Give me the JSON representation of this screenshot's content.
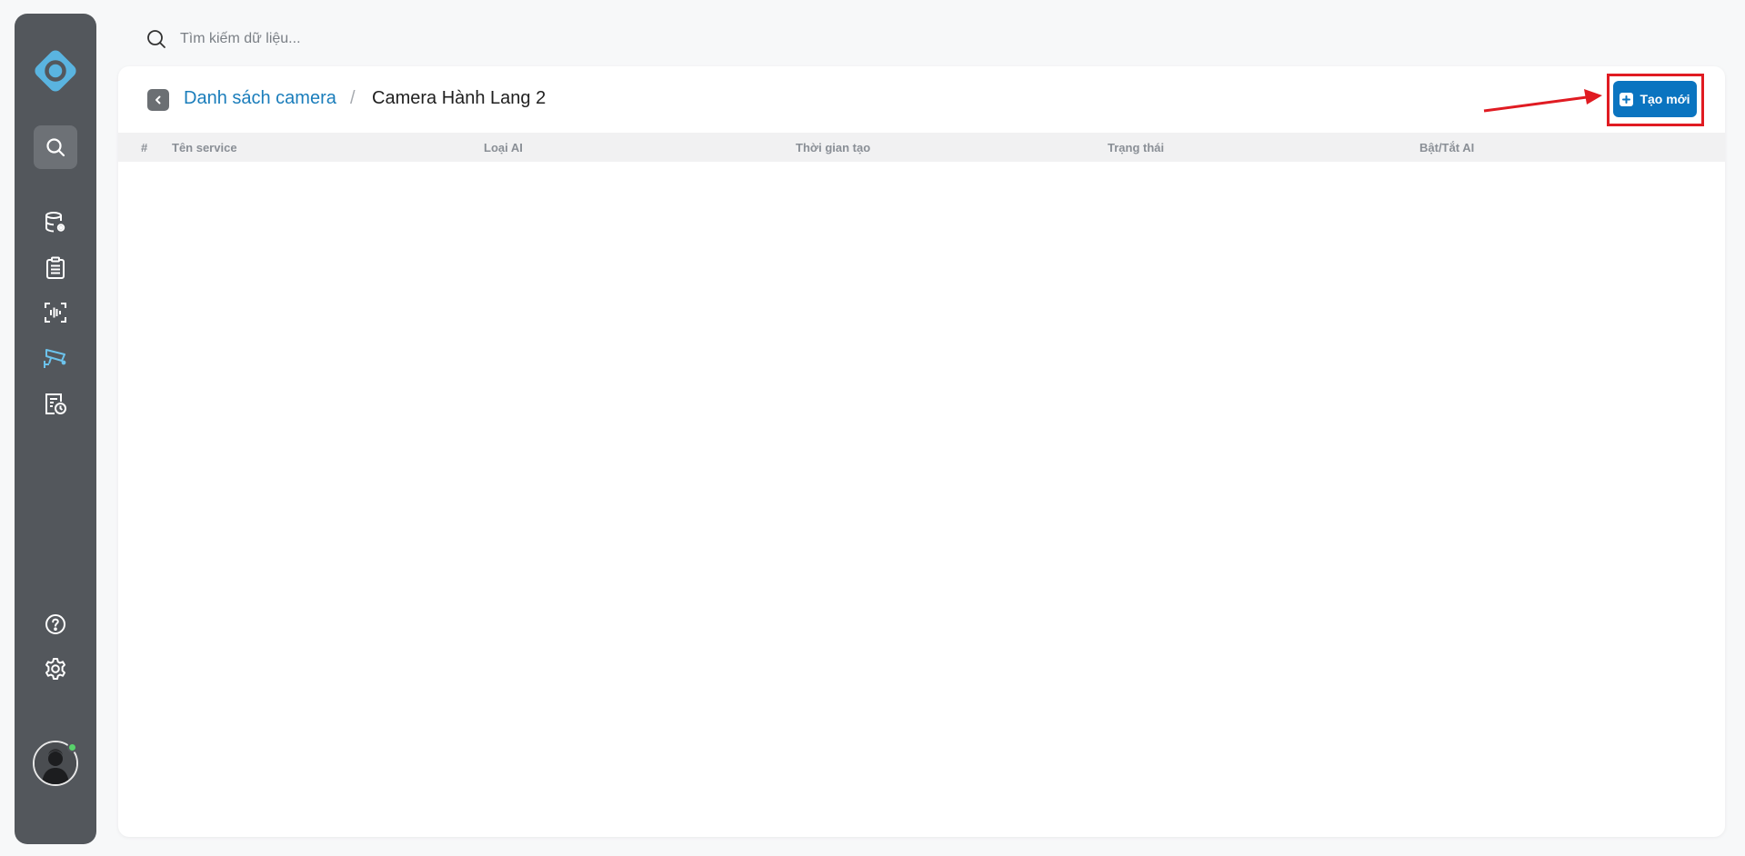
{
  "search": {
    "placeholder": "Tìm kiếm dữ liệu..."
  },
  "sidebar": {
    "items": [
      {
        "name": "search",
        "icon": "search-icon",
        "active": true
      },
      {
        "name": "database",
        "icon": "database-settings-icon"
      },
      {
        "name": "clipboard",
        "icon": "clipboard-list-icon"
      },
      {
        "name": "face-scan",
        "icon": "face-scan-icon"
      },
      {
        "name": "camera",
        "icon": "cctv-camera-icon"
      },
      {
        "name": "reports",
        "icon": "report-clock-icon"
      },
      {
        "name": "help",
        "icon": "help-icon"
      },
      {
        "name": "settings",
        "icon": "gear-icon"
      }
    ]
  },
  "breadcrumb": {
    "parent": "Danh sách camera",
    "separator": "/",
    "current": "Camera Hành Lang 2"
  },
  "actions": {
    "create_label": "Tạo mới"
  },
  "table": {
    "columns": [
      "#",
      "Tên service",
      "Loại AI",
      "Thời gian tạo",
      "Trạng thái",
      "Bật/Tắt AI"
    ],
    "rows": []
  },
  "colors": {
    "sidebar_bg": "#53575c",
    "accent": "#0a74c0",
    "link": "#1a7dbb",
    "highlight": "#e01b22",
    "logo": "#5ab4e0"
  }
}
